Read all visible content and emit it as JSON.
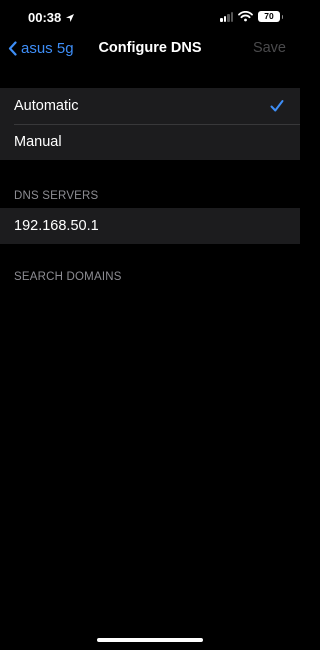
{
  "status_bar": {
    "time": "00:38",
    "battery": "70"
  },
  "nav": {
    "back_label": "asus 5g",
    "title": "Configure DNS",
    "save_label": "Save"
  },
  "mode_options": [
    {
      "label": "Automatic",
      "selected": true
    },
    {
      "label": "Manual",
      "selected": false
    }
  ],
  "dns_servers": {
    "header": "DNS SERVERS",
    "items": [
      "192.168.50.1"
    ]
  },
  "search_domains": {
    "header": "SEARCH DOMAINS"
  },
  "colors": {
    "accent": "#3e8ef7",
    "background": "#000000",
    "cell": "#1c1c1e",
    "secondary_text": "#8d8d93",
    "disabled": "#4a4a4c"
  }
}
